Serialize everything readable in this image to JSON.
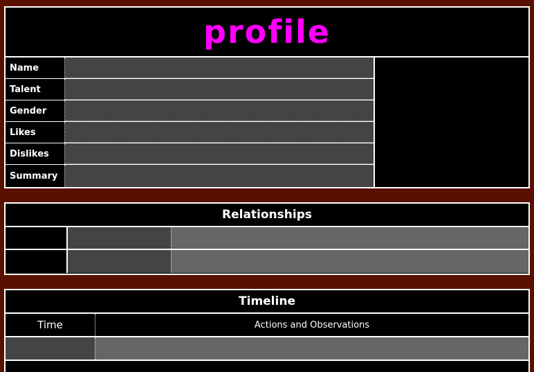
{
  "profile": {
    "title": "Profile",
    "title_color": "#ff00ff",
    "fields": [
      {
        "label": "Name"
      },
      {
        "label": "Talent"
      },
      {
        "label": "Gender"
      },
      {
        "label": "Likes"
      },
      {
        "label": "Dislikes"
      },
      {
        "label": "Summary"
      }
    ]
  },
  "relationships": {
    "title": "Relationships"
  },
  "timeline": {
    "title": "Timeline",
    "col_time": "Time",
    "col_actions": "Actions and Observations"
  },
  "colors": {
    "background": "#5a1000",
    "border": "#ffffff",
    "dark_cell": "#444444",
    "light_cell": "#666666",
    "header_bg": "#000000"
  }
}
